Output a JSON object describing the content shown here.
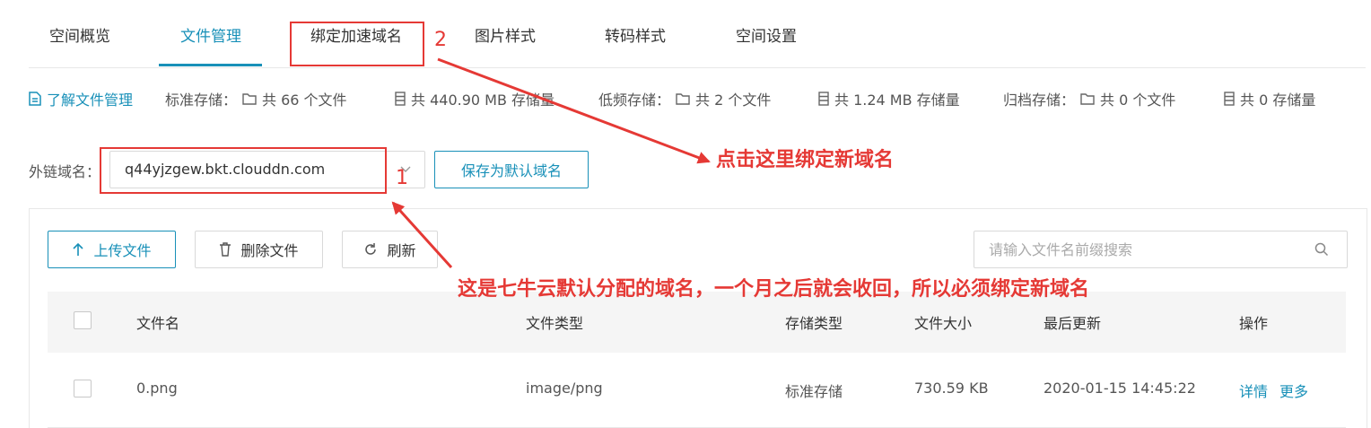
{
  "tabs": [
    {
      "label": "空间概览",
      "active": false
    },
    {
      "label": "文件管理",
      "active": true
    },
    {
      "label": "绑定加速域名",
      "active": false
    },
    {
      "label": "图片样式",
      "active": false
    },
    {
      "label": "转码样式",
      "active": false
    },
    {
      "label": "空间设置",
      "active": false
    }
  ],
  "stats": {
    "learn_link": "了解文件管理",
    "standard_label": "标准存储：",
    "standard_files": "共 66 个文件",
    "standard_size": "共 440.90 MB 存储量",
    "low_label": "低频存储：",
    "low_files": "共 2 个文件",
    "low_size": "共 1.24 MB 存储量",
    "archive_label": "归档存储：",
    "archive_files": "共 0 个文件",
    "archive_size": "共 0 存储量"
  },
  "domain": {
    "label": "外链域名：",
    "value": "q44yjzgew.bkt.clouddn.com",
    "save_default": "保存为默认域名"
  },
  "toolbar": {
    "upload": "上传文件",
    "delete": "删除文件",
    "refresh": "刷新",
    "search_placeholder": "请输入文件名前缀搜索"
  },
  "table": {
    "headers": [
      "文件名",
      "文件类型",
      "存储类型",
      "文件大小",
      "最后更新",
      "操作"
    ],
    "rows": [
      {
        "name": "0.png",
        "type": "image/png",
        "storage": "标准存储",
        "size": "730.59 KB",
        "updated": "2020-01-15 14:45:22",
        "action_detail": "详情",
        "action_more": "更多"
      }
    ]
  },
  "annotations": {
    "num1": "1",
    "num2": "2",
    "text_bind": "点击这里绑定新域名",
    "text_default": "这是七牛云默认分配的域名，一个月之后就会收回，所以必须绑定新域名"
  },
  "colors": {
    "accent": "#1890b8",
    "annotation": "#e53935"
  }
}
